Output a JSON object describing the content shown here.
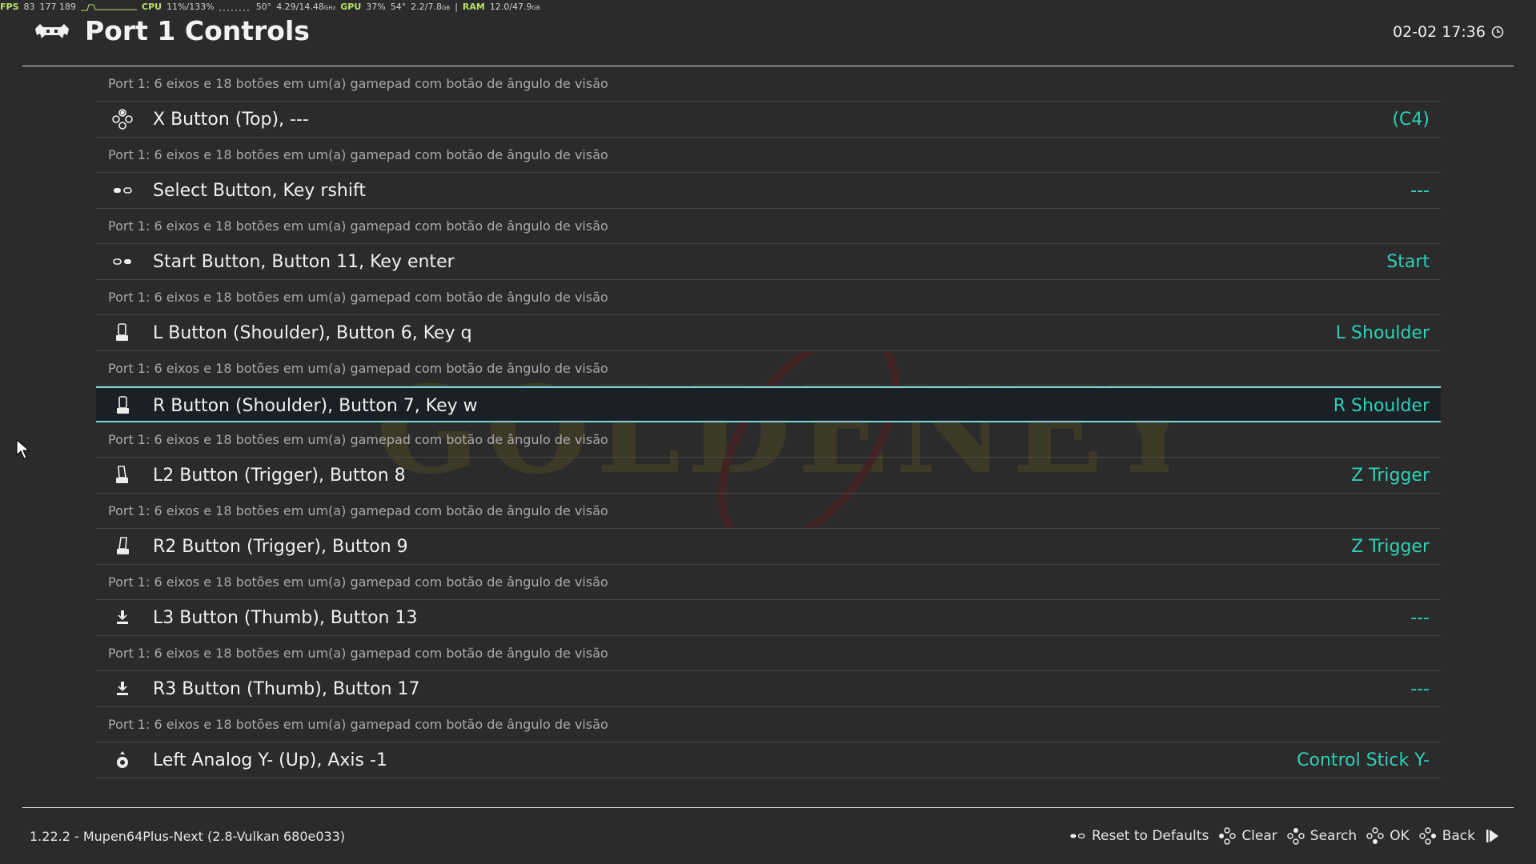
{
  "osd": {
    "fps_label": "FPS",
    "fps": "83",
    "frames": "177 189",
    "cpu_label": "CPU",
    "cpu": "11%/133%",
    "cpu_temp": "50°",
    "cpu_clock": "4.29/14.48",
    "cpu_clock_unit": "GHz",
    "gpu_label": "GPU",
    "gpu": "37%",
    "gpu_temp": "54°",
    "gpu_mem": "2.2/7.8",
    "gpu_mem_unit": "GB",
    "sep": "|",
    "ram_label": "RAM",
    "ram": "12.0/47.9",
    "ram_unit": "GB"
  },
  "header": {
    "title": "Port 1 Controls",
    "clock": "02-02 17:36"
  },
  "list": {
    "items": [
      {
        "icon": "button-top-icon",
        "label": "X Button (Top), ---",
        "value": "(C4)",
        "description": "Port 1: 6 eixos e 18 botões em um(a) gamepad com botão de ângulo de visão",
        "selected": false
      },
      {
        "icon": "select-button-icon",
        "label": "Select Button, Key rshift",
        "value": "---",
        "description": "Port 1: 6 eixos e 18 botões em um(a) gamepad com botão de ângulo de visão",
        "selected": false
      },
      {
        "icon": "start-button-icon",
        "label": "Start Button, Button 11, Key enter",
        "value": "Start",
        "description": "Port 1: 6 eixos e 18 botões em um(a) gamepad com botão de ângulo de visão",
        "selected": false
      },
      {
        "icon": "left-shoulder-icon",
        "label": "L Button (Shoulder), Button 6, Key q",
        "value": "L Shoulder",
        "description": "Port 1: 6 eixos e 18 botões em um(a) gamepad com botão de ângulo de visão",
        "selected": false
      },
      {
        "icon": "right-shoulder-icon",
        "label": "R Button (Shoulder), Button 7, Key w",
        "value": "R Shoulder",
        "description": "Port 1: 6 eixos e 18 botões em um(a) gamepad com botão de ângulo de visão",
        "selected": true
      },
      {
        "icon": "left-trigger-icon",
        "label": "L2 Button (Trigger), Button 8",
        "value": "Z Trigger",
        "description": "Port 1: 6 eixos e 18 botões em um(a) gamepad com botão de ângulo de visão",
        "selected": false
      },
      {
        "icon": "right-trigger-icon",
        "label": "R2 Button (Trigger), Button 9",
        "value": "Z Trigger",
        "description": "Port 1: 6 eixos e 18 botões em um(a) gamepad com botão de ângulo de visão",
        "selected": false
      },
      {
        "icon": "left-thumb-icon",
        "label": "L3 Button (Thumb), Button 13",
        "value": "---",
        "description": "Port 1: 6 eixos e 18 botões em um(a) gamepad com botão de ângulo de visão",
        "selected": false
      },
      {
        "icon": "right-thumb-icon",
        "label": "R3 Button (Thumb), Button 17",
        "value": "---",
        "description": "Port 1: 6 eixos e 18 botões em um(a) gamepad com botão de ângulo de visão",
        "selected": false
      },
      {
        "icon": "left-analog-up-icon",
        "label": "Left Analog Y- (Up), Axis -1",
        "value": "Control Stick Y-",
        "description": "",
        "selected": false
      }
    ],
    "top_description": "Port 1: 6 eixos e 18 botões em um(a) gamepad com botão de ângulo de visão"
  },
  "footer": {
    "version": "1.22.2 - Mupen64Plus-Next (2.8-Vulkan 680e033)",
    "hints": [
      {
        "icon": "select-button-icon",
        "label": "Reset to Defaults"
      },
      {
        "icon": "face-buttons-left-icon",
        "label": "Clear"
      },
      {
        "icon": "face-buttons-top-icon",
        "label": "Search"
      },
      {
        "icon": "face-buttons-bottom-icon",
        "label": "OK"
      },
      {
        "icon": "face-buttons-right-icon",
        "label": "Back"
      }
    ],
    "next_icon": "skip-next-icon"
  },
  "colors": {
    "background": "#2b2b2b",
    "value_text": "#2fd0b6",
    "selection_border": "#7fd6d8",
    "osd_accent": "#b9e06a"
  }
}
